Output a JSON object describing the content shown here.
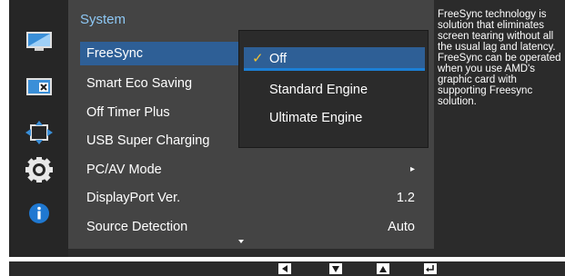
{
  "sidebar": {
    "icons": [
      "picture-icon",
      "onscreen-display-icon",
      "position-size-icon",
      "system-gear-icon",
      "information-icon"
    ]
  },
  "panel": {
    "title": "System"
  },
  "menu": {
    "items": [
      {
        "label": "FreeSync",
        "value": ""
      },
      {
        "label": "Smart Eco Saving",
        "value": ""
      },
      {
        "label": "Off Timer Plus",
        "value": ""
      },
      {
        "label": "USB Super Charging",
        "value": ""
      },
      {
        "label": "PC/AV Mode",
        "value": "▸"
      },
      {
        "label": "DisplayPort Ver.",
        "value": "1.2"
      },
      {
        "label": "Source Detection",
        "value": "Auto"
      }
    ]
  },
  "submenu": {
    "options": [
      {
        "label": "Off",
        "checked": true
      },
      {
        "label": "Standard Engine",
        "checked": false
      },
      {
        "label": "Ultimate Engine",
        "checked": false
      }
    ],
    "check_glyph": "✓"
  },
  "help": {
    "text": "FreeSync technology is solution that eliminates screen tearing without all the usual lag and latency. FreeSync can be operated when you use AMD's graphic card with supporting Freesync solution."
  },
  "keys": [
    "left-arrow-icon",
    "down-arrow-icon",
    "up-arrow-icon",
    "enter-icon"
  ],
  "colors": {
    "accent": "#2e5f96",
    "check": "#f2c230",
    "title": "#8ec8f5"
  }
}
